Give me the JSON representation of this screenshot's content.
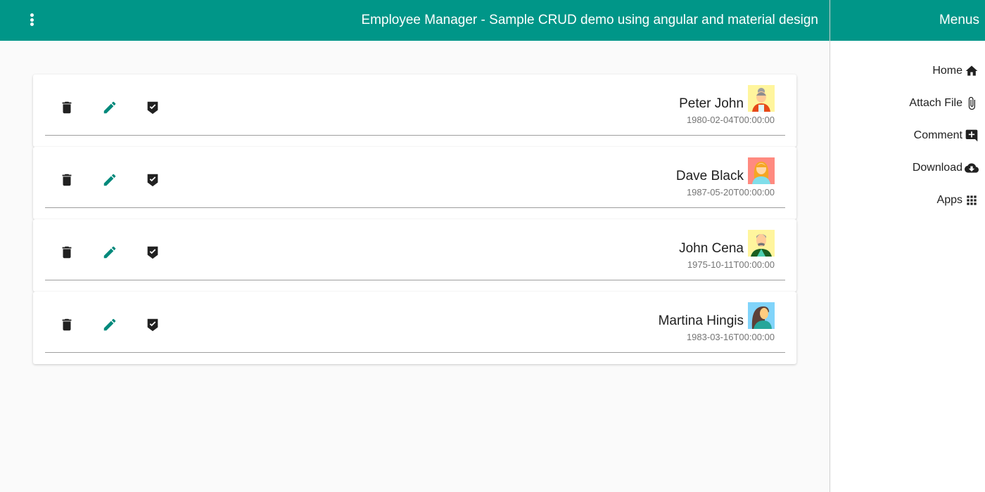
{
  "header": {
    "title": "Employee Manager - Sample CRUD demo using angular and material design",
    "menu_icon": "more-vert-icon"
  },
  "sidenav": {
    "title": "Menus",
    "items": [
      {
        "label": "Home",
        "icon": "home-icon"
      },
      {
        "label": "Attach File",
        "icon": "attach-file-icon"
      },
      {
        "label": "Comment",
        "icon": "add-comment-icon"
      },
      {
        "label": "Download",
        "icon": "cloud-download-icon"
      },
      {
        "label": "Apps",
        "icon": "apps-icon"
      }
    ]
  },
  "colors": {
    "primary": "#009688",
    "edit_icon": "#00897b",
    "icon_dark": "#212121"
  },
  "employees": [
    {
      "name": "Peter John",
      "dob": "1980-02-04T00:00:00",
      "avatar": "elderly-woman-avatar",
      "avatar_bg": "#fff59d"
    },
    {
      "name": "Dave Black",
      "dob": "1987-05-20T00:00:00",
      "avatar": "blonde-woman-avatar",
      "avatar_bg": "#ff8a80"
    },
    {
      "name": "John Cena",
      "dob": "1975-10-11T00:00:00",
      "avatar": "elderly-man-avatar",
      "avatar_bg": "#fff59d"
    },
    {
      "name": "Martina Hingis",
      "dob": "1983-03-16T00:00:00",
      "avatar": "brunette-woman-avatar",
      "avatar_bg": "#81d4fa"
    }
  ]
}
